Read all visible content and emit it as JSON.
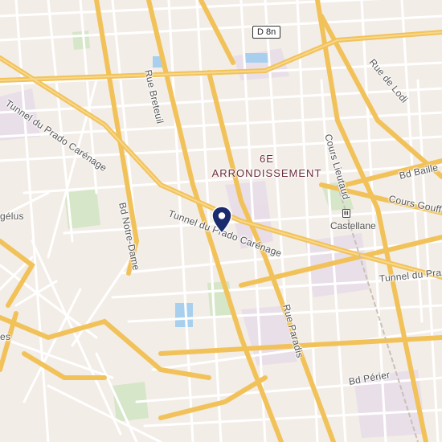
{
  "map": {
    "road_shield": "D 8n",
    "district": {
      "line1": "6E",
      "line2": "ARRONDISSEMENT"
    },
    "station": {
      "name": "Castellane",
      "icon": "metro-icon"
    },
    "streets": [
      {
        "id": "tunnel-prado-carenage-nw",
        "text": "Tunnel du Prado Carénage"
      },
      {
        "id": "rue-breteuil",
        "text": "Rue Breteuil"
      },
      {
        "id": "bd-notre-dame",
        "text": "Bd Notre-Dame"
      },
      {
        "id": "tunnel-prado-carenage-center",
        "text": "Tunnel du Prado Carénage"
      },
      {
        "id": "cours-lieutaud",
        "text": "Cours Lieutaud"
      },
      {
        "id": "rue-de-lodi",
        "text": "Rue de Lodi"
      },
      {
        "id": "bd-baille",
        "text": "Bd Baille"
      },
      {
        "id": "cours-gouffe",
        "text": "Cours Gouff"
      },
      {
        "id": "tunnel-du-pra",
        "text": "Tunnel du Pra"
      },
      {
        "id": "rue-paradis",
        "text": "Rue Paradis"
      },
      {
        "id": "bd-perier",
        "text": "Bd Périer"
      },
      {
        "id": "angelus",
        "text": "gélus"
      },
      {
        "id": "edge-s",
        "text": "es"
      }
    ],
    "marker": {
      "icon": "location-pin-icon",
      "color": "#1a2a6c"
    },
    "colors": {
      "background": "#f3ede7",
      "major_road": "#f5c95f",
      "minor_road": "#ffffff",
      "park": "#cfe3c0",
      "water": "#a8d0ee",
      "landuse": "#e6dcea"
    }
  }
}
